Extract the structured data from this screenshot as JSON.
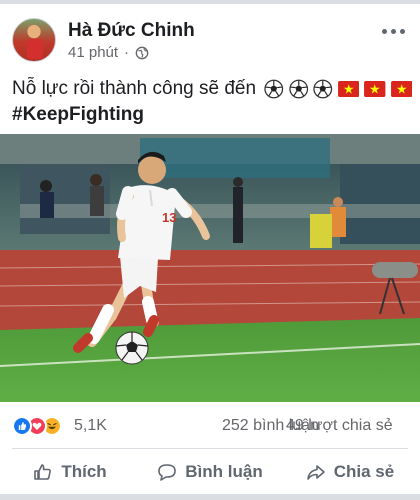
{
  "post": {
    "author": "Hà Đức Chinh",
    "time": "41 phút",
    "privacy_icon": "globe-icon",
    "text": "Nỗ lực rồi thành công sẽ đến",
    "emojis": [
      "soccer-ball",
      "soccer-ball",
      "soccer-ball",
      "vietnam-flag",
      "vietnam-flag",
      "vietnam-flag"
    ],
    "hashtag": "#KeepFighting"
  },
  "photo": {
    "jersey_number": "13"
  },
  "stats": {
    "reaction_icons": [
      "like",
      "love",
      "haha"
    ],
    "reactions": "5,1K",
    "comments": "252 bình luận",
    "shares": "49 lượt chia sẻ"
  },
  "actions": {
    "like_label": "Thích",
    "comment_label": "Bình luận",
    "share_label": "Chia sẻ"
  },
  "colors": {
    "like": "#1877f2",
    "love": "#f33e58",
    "haha": "#f7b125",
    "muted": "#606770",
    "flag_red": "#da251d",
    "flag_star": "#ffff00"
  }
}
